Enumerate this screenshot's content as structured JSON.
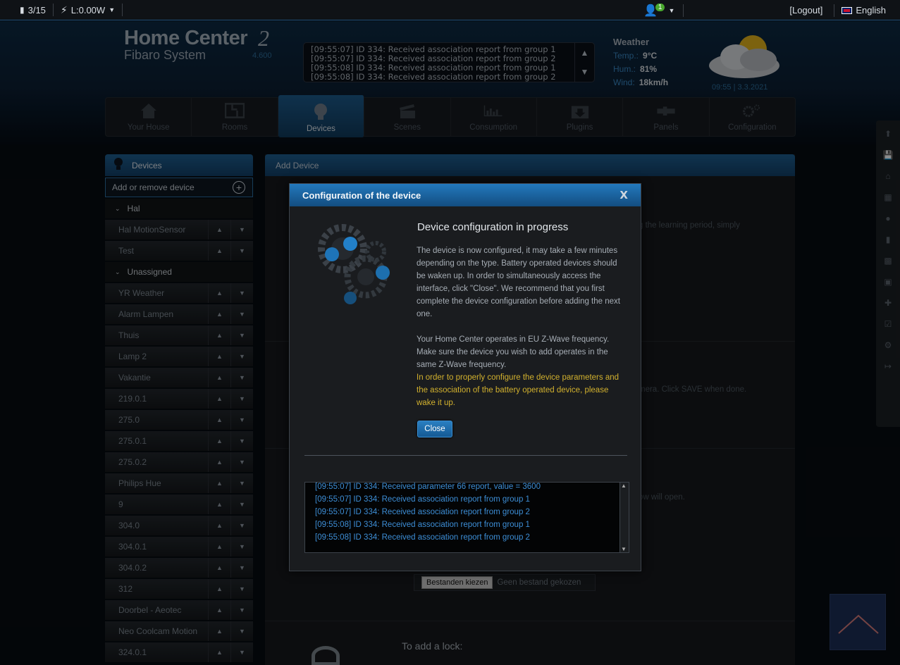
{
  "topbar": {
    "scenes_count": "3/15",
    "power": "L:0.00W",
    "user_badge": "1",
    "logout": "[Logout]",
    "language": "English"
  },
  "header": {
    "logo_title": "Home Center",
    "logo_number": "2",
    "logo_sub": "Fibaro System",
    "version": "4.600",
    "events": [
      "[09:55:07] ID 334: Received association report from group 1",
      "[09:55:07] ID 334: Received association report from group 2",
      "[09:55:08] ID 334: Received association report from group 1",
      "[09:55:08] ID 334: Received association report from group 2"
    ],
    "weather": {
      "title": "Weather",
      "temp_label": "Temp.:",
      "temp_value": "9°C",
      "hum_label": "Hum.:",
      "hum_value": "81%",
      "wind_label": "Wind:",
      "wind_value": "18km/h",
      "datetime": "09:55 | 3.3.2021"
    }
  },
  "nav": {
    "items": [
      "Your House",
      "Rooms",
      "Devices",
      "Scenes",
      "Consumption",
      "Plugins",
      "Panels",
      "Configuration"
    ],
    "active": "Devices"
  },
  "sidebar": {
    "title": "Devices",
    "add_label": "Add or remove device",
    "group_hal": "Hal",
    "hal_items": [
      "Hal MotionSensor",
      "Test"
    ],
    "group_unassigned": "Unassigned",
    "unassigned_items": [
      "YR Weather",
      "Alarm Lampen",
      "Thuis",
      "Lamp 2",
      "Vakantie",
      "219.0.1",
      "275.0",
      "275.0.1",
      "275.0.2",
      "Philips Hue",
      "9",
      "304.0",
      "304.0.1",
      "304.0.2",
      "312",
      "Doorbel - Aeotec",
      "Neo Coolcam Motion",
      "324.0.1"
    ]
  },
  "main": {
    "title": "Add Device",
    "bg_text_1": "g the learning period, simply",
    "bg_text_2": "mera. Click SAVE when done.",
    "bg_text_3": "ow will open.",
    "file_button": "Bestanden kiezen",
    "file_status": "Geen bestand gekozen",
    "lock_heading": "To add a lock:"
  },
  "modal": {
    "header": "Configuration of the device",
    "close_x": "X",
    "title": "Device configuration in progress",
    "paragraph1": "The device is now configured, it may take a few minutes depending on the type. Battery operated devices should be waken up. In order to simultaneously access the interface, click \"Close\". We recommend that you first complete the device configuration before adding the next one.",
    "paragraph2": "Your Home Center operates in EU Z-Wave frequency. Make sure the device you wish to add operates in the same Z-Wave frequency.",
    "warning": "In order to properly configure the device parameters and the association of the battery operated device, please wake it up.",
    "close_button": "Close",
    "log": [
      "[09:55:07] ID 334: Received parameter 66 report, value = 3600",
      "[09:55:07] ID 334: Received association report from group 1",
      "[09:55:07] ID 334: Received association report from group 2",
      "[09:55:08] ID 334: Received association report from group 1",
      "[09:55:08] ID 334: Received association report from group 2"
    ]
  },
  "colors": {
    "accent": "#1e5f90",
    "warning": "#d2b12e",
    "log_text": "#3d8ed6"
  }
}
